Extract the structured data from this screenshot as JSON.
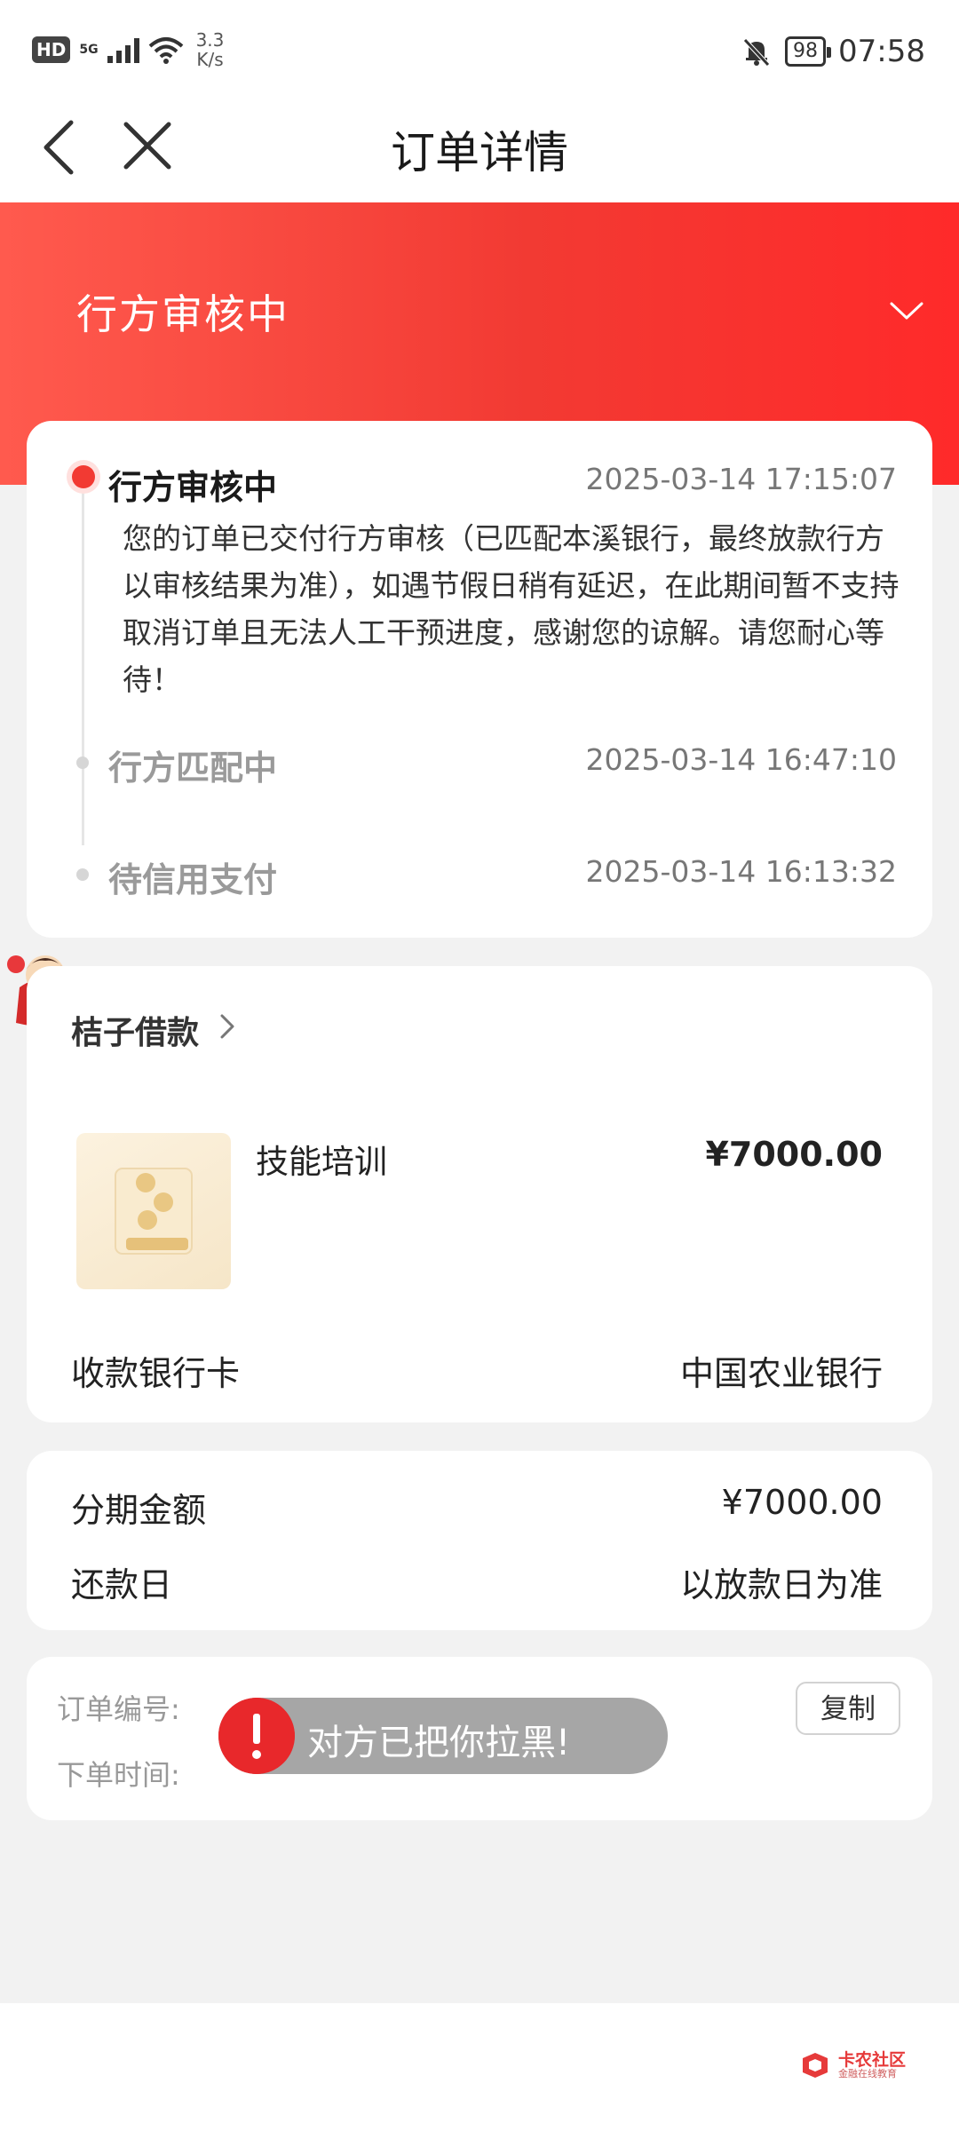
{
  "status_bar": {
    "hd": "HD",
    "network": "5G",
    "speed_value": "3.3",
    "speed_unit": "K/s",
    "battery": "98",
    "time": "07:58"
  },
  "nav": {
    "title": "订单详情"
  },
  "banner": {
    "status": "行方审核中"
  },
  "timeline": [
    {
      "title": "行方审核中",
      "time": "2025-03-14 17:15:07",
      "desc": "您的订单已交付行方审核（已匹配本溪银行，最终放款行方以审核结果为准），如遇节假日稍有延迟，在此期间暂不支持取消订单且无法人工干预进度，感谢您的谅解。请您耐心等待！"
    },
    {
      "title": "行方匹配中",
      "time": "2025-03-14 16:47:10"
    },
    {
      "title": "待信用支付",
      "time": "2025-03-14 16:13:32"
    }
  ],
  "goods": {
    "shop": "桔子借款",
    "item_name": "技能培训",
    "price": "¥7000.00",
    "bank_label": "收款银行卡",
    "bank_value": "中国农业银行"
  },
  "installment": {
    "amount_label": "分期金额",
    "amount_value": "¥7000.00",
    "repay_label": "还款日",
    "repay_value": "以放款日为准"
  },
  "order": {
    "number_label": "订单编号:",
    "time_label": "下单时间:",
    "copy_label": "复制"
  },
  "toast": {
    "text": "对方已把你拉黑!"
  },
  "watermark": {
    "main": "卡农社区",
    "sub": "金融在线教育"
  },
  "colors": {
    "accent": "#f23a33",
    "toast_icon": "#e8282b"
  }
}
